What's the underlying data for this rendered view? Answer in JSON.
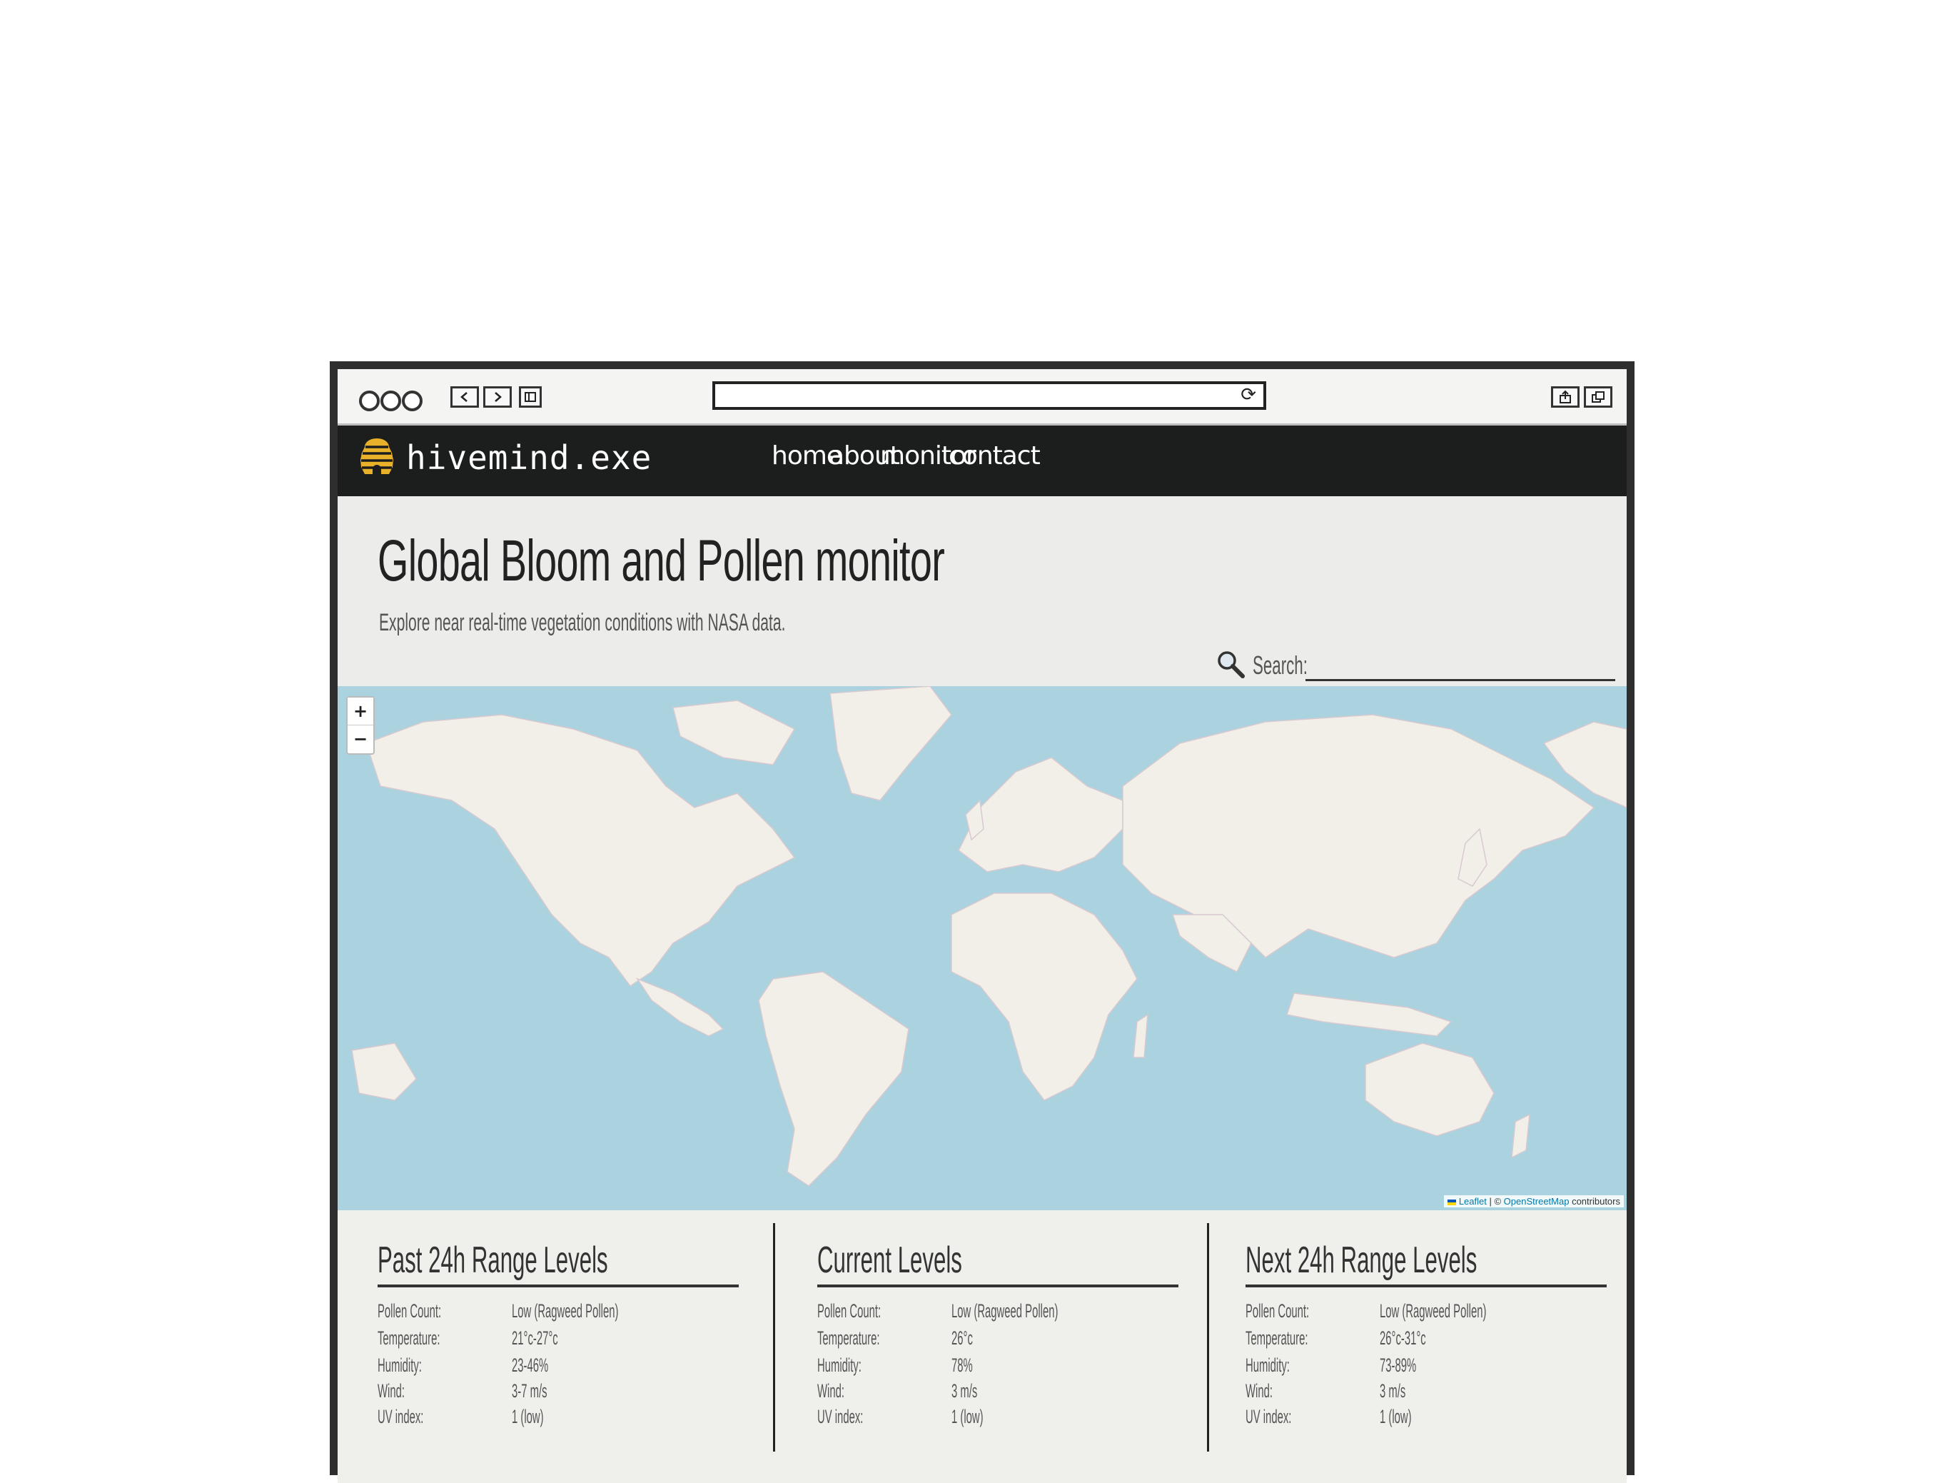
{
  "browser": {
    "reload_icon": "reload-icon",
    "share_icon": "share-icon",
    "tabs_icon": "tabs-icon"
  },
  "navbar": {
    "brand": "hivemind.exe",
    "logo_icon": "beehive-icon",
    "links": [
      "home",
      "about",
      "monitor",
      "contact"
    ]
  },
  "header": {
    "title": "Global Bloom and Pollen monitor",
    "subtitle": "Explore near real-time vegetation conditions with NASA data."
  },
  "search": {
    "label": "Search:",
    "placeholder": ""
  },
  "map": {
    "zoom_in": "+",
    "zoom_out": "−",
    "attribution_leaflet": "Leaflet",
    "attribution_sep": " | © ",
    "attribution_osm": "OpenStreetMap",
    "attribution_tail": " contributors",
    "water_color": "#aad3df",
    "land_color": "#f2efe9"
  },
  "panels": [
    {
      "title": "Past 24h Range Levels",
      "rows": [
        {
          "label": "Pollen Count:",
          "value": "Low (Ragweed Pollen)"
        },
        {
          "label": "Temperature:",
          "value": "21°c-27°c"
        },
        {
          "label": "Humidity:",
          "value": "23-46%"
        },
        {
          "label": "Wind:",
          "value": "3-7 m/s"
        },
        {
          "label": "UV index:",
          "value": "1 (low)"
        }
      ]
    },
    {
      "title": "Current Levels",
      "rows": [
        {
          "label": "Pollen Count:",
          "value": "Low (Ragweed Pollen)"
        },
        {
          "label": "Temperature:",
          "value": "26°c"
        },
        {
          "label": "Humidity:",
          "value": "78%"
        },
        {
          "label": "Wind:",
          "value": "3 m/s"
        },
        {
          "label": "UV index:",
          "value": "1 (low)"
        }
      ]
    },
    {
      "title": "Next 24h Range Levels",
      "rows": [
        {
          "label": "Pollen Count:",
          "value": "Low (Ragweed Pollen)"
        },
        {
          "label": "Temperature:",
          "value": "26°c-31°c"
        },
        {
          "label": "Humidity:",
          "value": "73-89%"
        },
        {
          "label": "Wind:",
          "value": "3 m/s"
        },
        {
          "label": "UV index:",
          "value": "1 (low)"
        }
      ]
    }
  ]
}
